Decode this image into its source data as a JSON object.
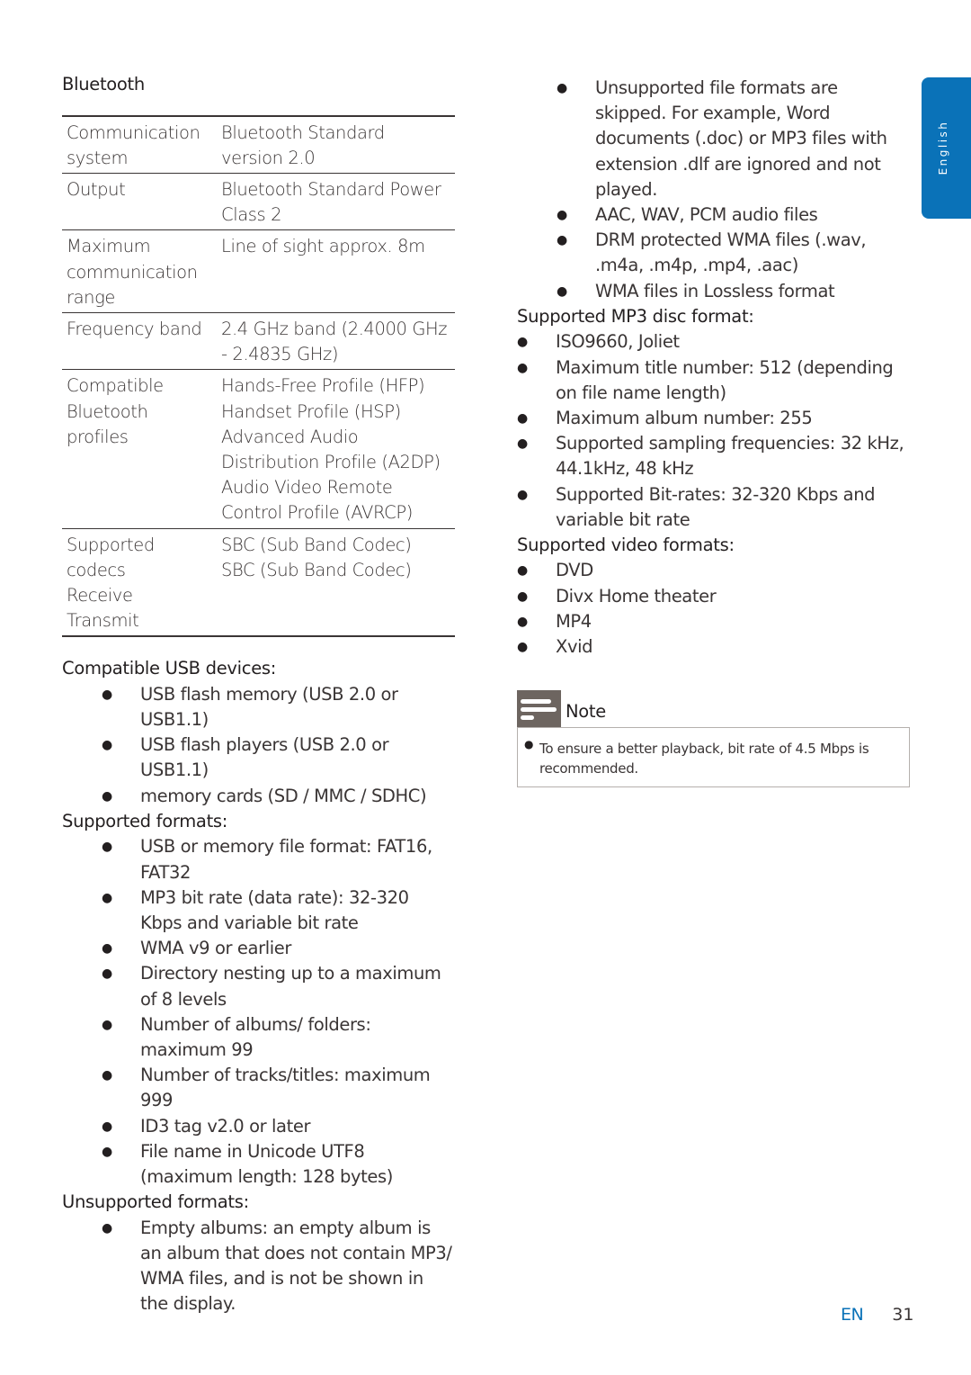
{
  "language_tab": {
    "label": "English",
    "color": "#0a72b8"
  },
  "bluetooth": {
    "title": "Bluetooth",
    "rows": [
      {
        "key": "Communication system",
        "value": "Bluetooth Standard version 2.0"
      },
      {
        "key": "Output",
        "value": "Bluetooth Standard Power Class 2"
      },
      {
        "key": "Maximum communication range",
        "value": "Line of sight approx. 8m"
      },
      {
        "key": "Frequency band",
        "value": "2.4 GHz band (2.4000 GHz - 2.4835 GHz)"
      },
      {
        "key": "Compatible Bluetooth profiles",
        "value_lines": [
          "Hands-Free Profile (HFP)",
          "Handset Profile (HSP)",
          "Advanced Audio Distribution Profile (A2DP)",
          "Audio Video Remote Control Profile (AVRCP)"
        ]
      },
      {
        "key_lines": [
          "Supported codecs",
          "Receive",
          "Transmit"
        ],
        "value_lines": [
          "SBC (Sub Band Codec)",
          "SBC (Sub Band Codec)"
        ]
      }
    ]
  },
  "usb_devices": {
    "title": "Compatible USB devices:",
    "items": [
      "USB flash memory (USB 2.0 or USB1.1)",
      "USB flash players (USB 2.0 or USB1.1)",
      "memory cards (SD / MMC / SDHC)"
    ]
  },
  "supported_formats": {
    "title": "Supported formats:",
    "items": [
      "USB or memory file format: FAT16, FAT32",
      "MP3 bit rate (data rate): 32-320 Kbps and variable bit rate",
      "WMA v9 or earlier",
      "Directory nesting up to a maximum of 8 levels",
      "Number of albums/ folders: maximum 99",
      "Number of tracks/titles: maximum 999",
      "ID3 tag v2.0 or later",
      "File name in Unicode UTF8 (maximum length: 128 bytes)"
    ]
  },
  "unsupported_formats": {
    "title": "Unsupported formats:",
    "items": [
      "Empty albums: an empty album is an album that does not contain MP3/ WMA files, and is not be shown in the display.",
      "Unsupported file formats are skipped. For example, Word documents (.doc) or MP3 files with extension .dlf are ignored and not played.",
      "AAC, WAV, PCM audio files",
      "DRM protected WMA files (.wav, .m4a, .m4p, .mp4, .aac)",
      "WMA files in Lossless format"
    ]
  },
  "mp3_disc": {
    "title": "Supported MP3 disc format:",
    "items": [
      "ISO9660, Joliet",
      "Maximum title number: 512 (depending on file name length)",
      "Maximum album number: 255",
      "Supported sampling frequencies: 32 kHz, 44.1kHz, 48 kHz",
      "Supported Bit-rates: 32-320 Kbps and variable bit rate"
    ]
  },
  "video_formats": {
    "title": "Supported video formats:",
    "items": [
      "DVD",
      "Divx Home theater",
      "MP4",
      "Xvid"
    ]
  },
  "note": {
    "title": "Note",
    "text": "To ensure a better playback, bit rate of 4.5 Mbps is recommended."
  },
  "footer": {
    "lang": "EN",
    "page": "31"
  }
}
